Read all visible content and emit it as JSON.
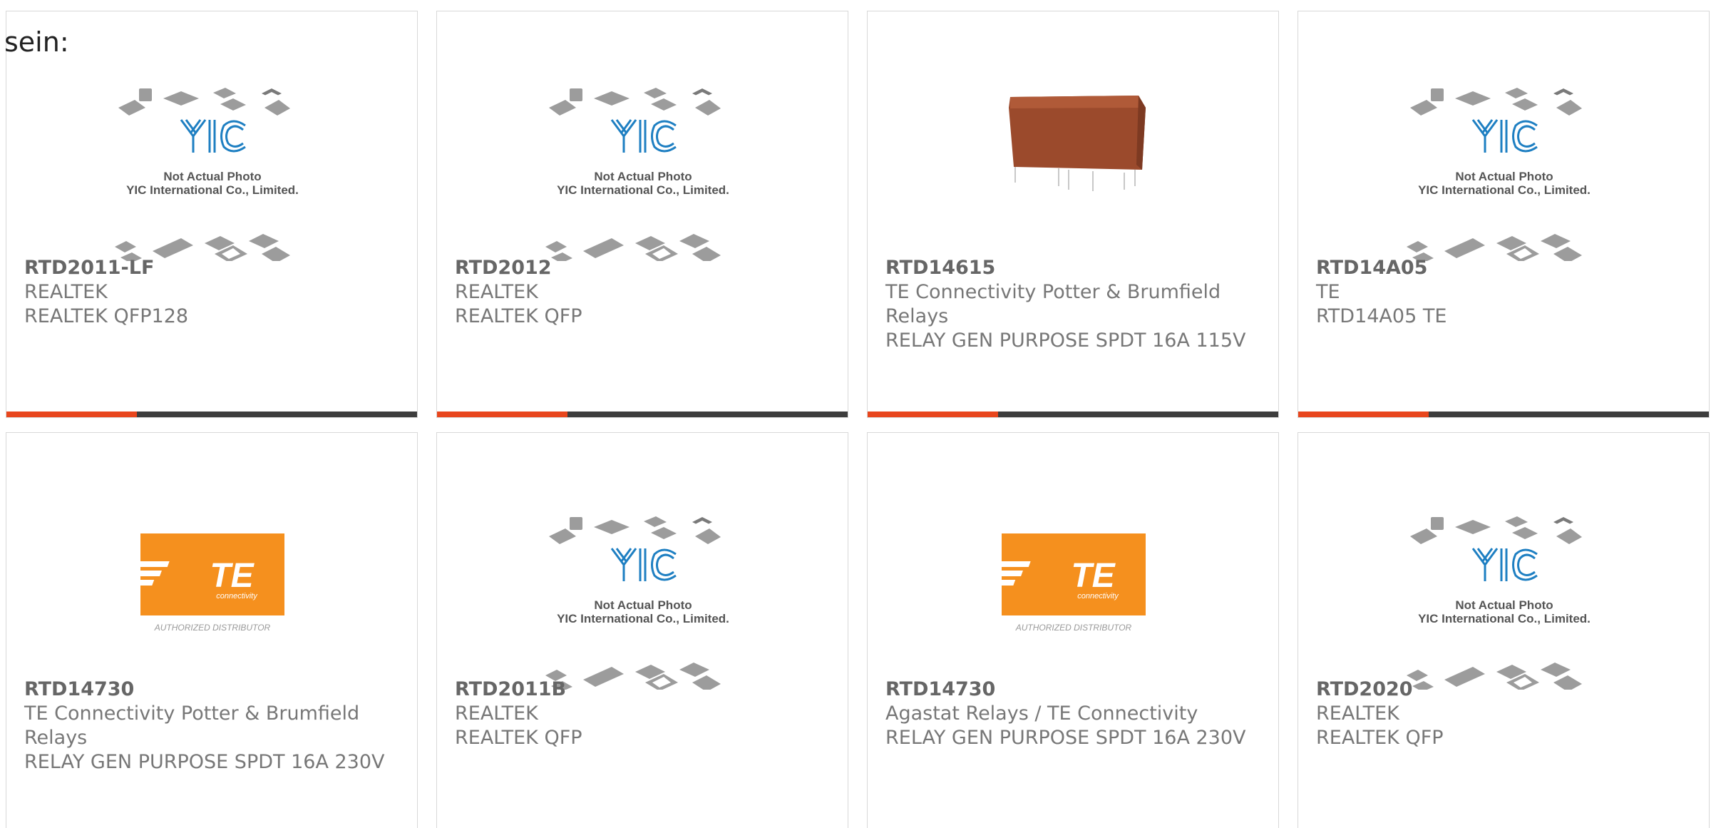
{
  "intro": "sein:",
  "placeholder": {
    "line1": "Not Actual Photo",
    "line2": "YIC International Co., Limited.",
    "logo_text": "YIC"
  },
  "te_logo": {
    "text": "TE",
    "sub": "connectivity",
    "caption": "AUTHORIZED DISTRIBUTOR"
  },
  "colors": {
    "accent": "#e8461d",
    "bar": "#3d3d3d",
    "te_orange": "#f5901e",
    "yic_blue": "#1e7fc2",
    "relay_brown": "#9b4a2c"
  },
  "products": [
    {
      "part": "RTD2011-LF",
      "maker": "REALTEK",
      "desc": "REALTEK QFP128",
      "image": "placeholder-icon"
    },
    {
      "part": "RTD2012",
      "maker": "REALTEK",
      "desc": "REALTEK QFP",
      "image": "placeholder-icon"
    },
    {
      "part": "RTD14615",
      "maker": "TE Connectivity Potter & Brumfield Relays",
      "desc": "RELAY GEN PURPOSE SPDT 16A 115V",
      "image": "relay-photo"
    },
    {
      "part": "RTD14A05",
      "maker": "TE",
      "desc": "RTD14A05 TE",
      "image": "placeholder-icon"
    },
    {
      "part": "RTD14730",
      "maker": "TE Connectivity Potter & Brumfield Relays",
      "desc": "RELAY GEN PURPOSE SPDT 16A 230V",
      "image": "te-logo"
    },
    {
      "part": "RTD2011B",
      "maker": "REALTEK",
      "desc": "REALTEK QFP",
      "image": "placeholder-icon"
    },
    {
      "part": "RTD14730",
      "maker": "Agastat Relays / TE Connectivity",
      "desc": "RELAY GEN PURPOSE SPDT 16A 230V",
      "image": "te-logo"
    },
    {
      "part": "RTD2020",
      "maker": "REALTEK",
      "desc": "REALTEK QFP",
      "image": "placeholder-icon"
    }
  ]
}
